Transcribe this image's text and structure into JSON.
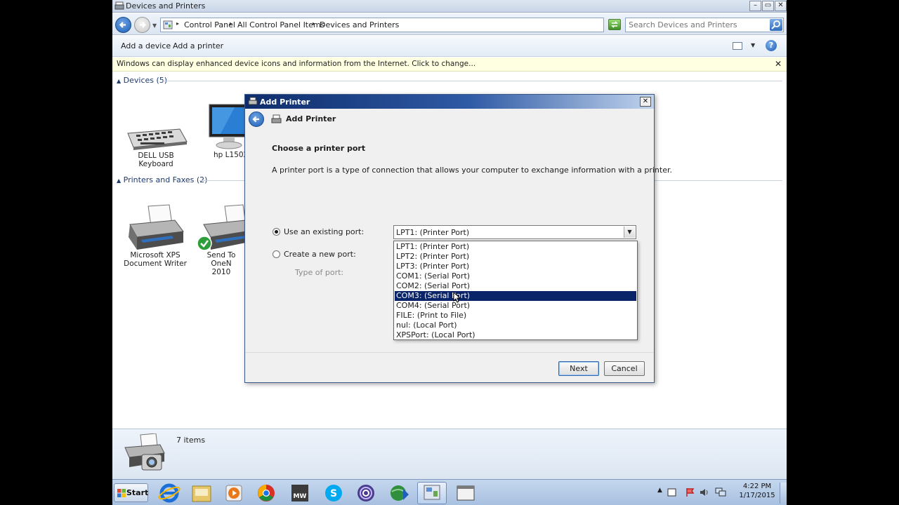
{
  "window": {
    "title": "Devices and Printers",
    "minimize": "–",
    "maximize": "▭",
    "close": "✕"
  },
  "address": {
    "crumbs": [
      "Control Panel",
      "All Control Panel Items",
      "Devices and Printers"
    ],
    "search_placeholder": "Search Devices and Printers"
  },
  "commands": {
    "add_device": "Add a device",
    "add_printer": "Add a printer",
    "help": "?"
  },
  "infobar": {
    "text": "Windows can display enhanced device icons and information from the Internet. Click to change...",
    "close": "✕"
  },
  "groups": {
    "devices": {
      "header": "Devices (5)",
      "items": [
        "DELL USB Keyboard",
        "hp L1502"
      ]
    },
    "printers": {
      "header": "Printers and Faxes (2)",
      "items": [
        {
          "line1": "Microsoft XPS",
          "line2": "Document Writer"
        },
        {
          "line1": "Send To OneN",
          "line2": "2010"
        }
      ]
    }
  },
  "status": {
    "count": "7 items"
  },
  "dialog": {
    "title": "Add Printer",
    "header": "Add Printer",
    "close": "✕",
    "heading": "Choose a printer port",
    "description": "A printer port is a type of connection that allows your computer to exchange information with a printer.",
    "use_existing_label": "Use an existing port:",
    "create_new_label": "Create a new port:",
    "type_of_port_label": "Type of port:",
    "selected_port": "LPT1: (Printer Port)",
    "ports": [
      "LPT1: (Printer Port)",
      "LPT2: (Printer Port)",
      "LPT3: (Printer Port)",
      "COM1: (Serial Port)",
      "COM2: (Serial Port)",
      "COM3: (Serial Port)",
      "COM4: (Serial Port)",
      "FILE: (Print to File)",
      "nul: (Local Port)",
      "XPSPort: (Local Port)"
    ],
    "highlighted_port": "COM3: (Serial Port)",
    "next": "Next",
    "cancel": "Cancel"
  },
  "taskbar": {
    "start": "Start",
    "time": "4:22 PM",
    "date": "1/17/2015"
  }
}
